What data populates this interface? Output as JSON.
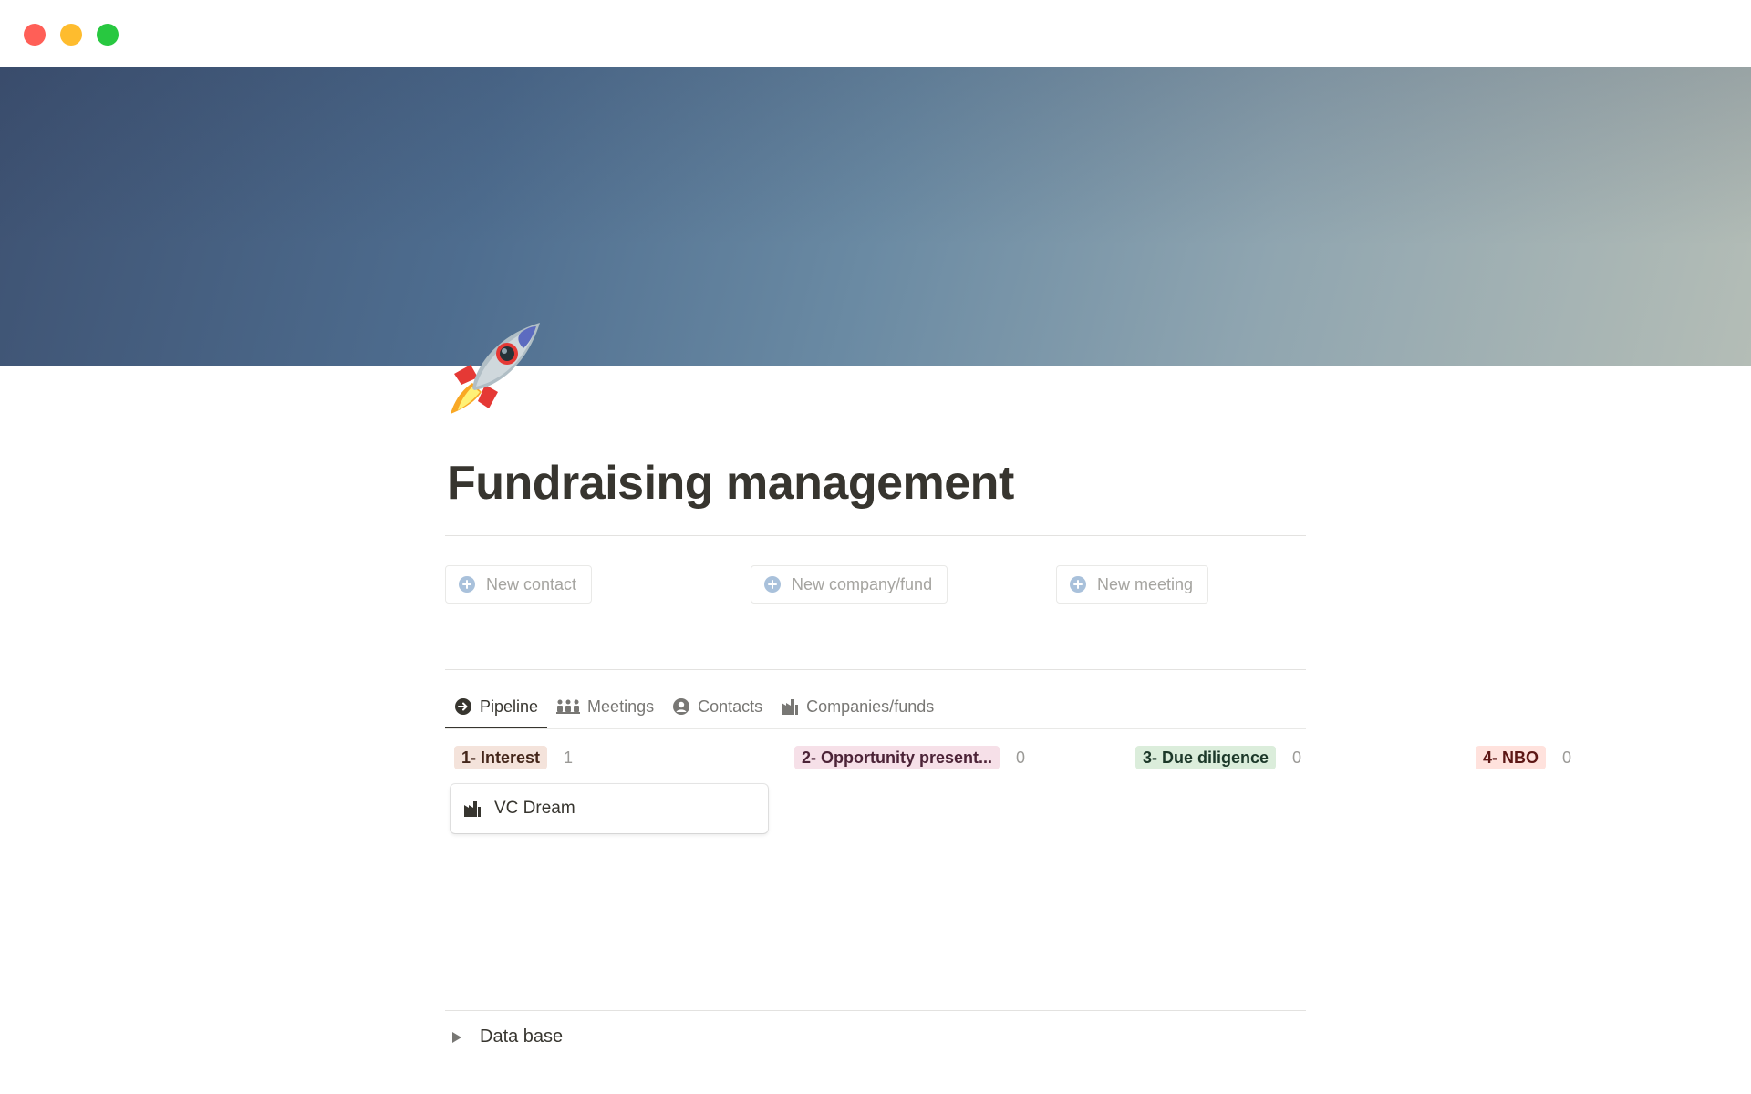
{
  "window": {
    "traffic_lights": [
      "close",
      "minimize",
      "maximize"
    ]
  },
  "page": {
    "icon": "rocket-icon",
    "title": "Fundraising management"
  },
  "actions": [
    {
      "label": "New contact",
      "icon": "plus-circle-icon"
    },
    {
      "label": "New company/fund",
      "icon": "plus-circle-icon"
    },
    {
      "label": "New meeting",
      "icon": "plus-circle-icon"
    }
  ],
  "tabs": [
    {
      "label": "Pipeline",
      "icon": "arrow-circle-icon",
      "active": true
    },
    {
      "label": "Meetings",
      "icon": "people-icon",
      "active": false
    },
    {
      "label": "Contacts",
      "icon": "person-circle-icon",
      "active": false
    },
    {
      "label": "Companies/funds",
      "icon": "factory-icon",
      "active": false
    }
  ],
  "board": {
    "columns": [
      {
        "label": "1- Interest",
        "count": "1",
        "bg": "#f4e3db",
        "fg": "#44261a"
      },
      {
        "label": "2- Opportunity present...",
        "count": "0",
        "bg": "#f6e0e8",
        "fg": "#4c2337"
      },
      {
        "label": "3- Due diligence",
        "count": "0",
        "bg": "#dbeddb",
        "fg": "#1c3829"
      },
      {
        "label": "4- NBO",
        "count": "0",
        "bg": "#ffe2dd",
        "fg": "#5d1715"
      }
    ],
    "cards": [
      {
        "title": "VC Dream",
        "icon": "factory-icon",
        "column": "1- Interest"
      }
    ]
  },
  "toggle": {
    "label": "Data base",
    "icon": "triangle-right-icon"
  },
  "colors": {
    "text": "#37352f",
    "muted": "#787774",
    "plus_icon": "#a9c1db"
  }
}
